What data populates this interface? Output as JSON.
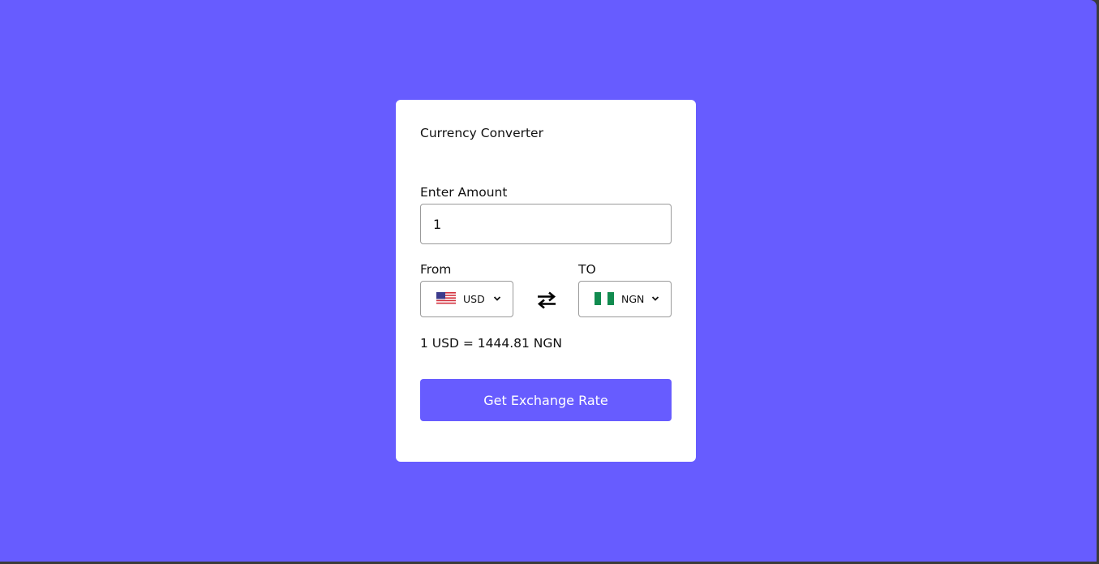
{
  "app": {
    "title": "Currency Converter"
  },
  "amount": {
    "label": "Enter Amount",
    "value": "1"
  },
  "from": {
    "label": "From",
    "currency": "USD",
    "flag_icon": "us-flag-icon"
  },
  "to": {
    "label": "TO",
    "currency": "NGN",
    "flag_icon": "nigeria-flag-icon"
  },
  "rate_text": "1 USD = 1444.81 NGN",
  "button": {
    "label": "Get Exchange Rate"
  },
  "colors": {
    "background": "#675cff",
    "card": "#ffffff",
    "button": "#675cff"
  }
}
